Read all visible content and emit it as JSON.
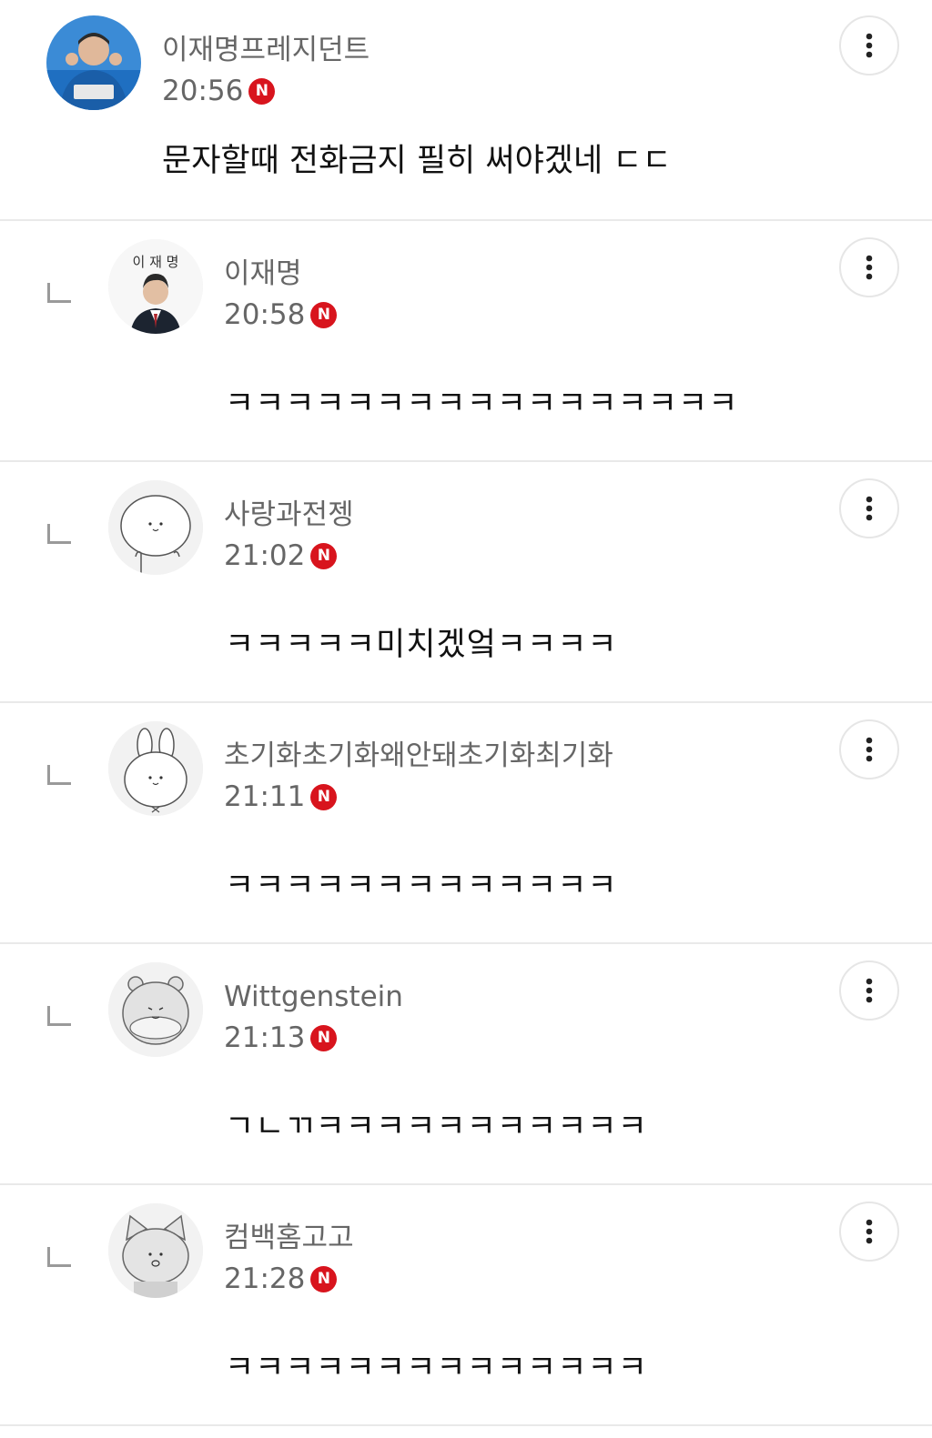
{
  "comments": [
    {
      "name": "이재명프레지던트",
      "time": "20:56",
      "badge": "N",
      "text": "문자할때 전화금지 필히 써야겠네 ㄷㄷ",
      "avatar": "photo-avatar-blue"
    },
    {
      "name": "이재명",
      "time": "20:58",
      "badge": "N",
      "text": "ㅋㅋㅋㅋㅋㅋㅋㅋㅋㅋㅋㅋㅋㅋㅋㅋㅋ",
      "avatar": "portrait-avatar",
      "avatar_caption": "이 재 명"
    },
    {
      "name": "사랑과전젱",
      "time": "21:02",
      "badge": "N",
      "text": "ㅋㅋㅋㅋㅋ미치겠엌ㅋㅋㅋㅋ",
      "avatar": "blob-character-avatar"
    },
    {
      "name": "초기화초기화왜안돼초기화최기화",
      "time": "21:11",
      "badge": "N",
      "text": "ㅋㅋㅋㅋㅋㅋㅋㅋㅋㅋㅋㅋㅋ",
      "avatar": "rabbit-character-avatar"
    },
    {
      "name": "Wittgenstein",
      "time": "21:13",
      "badge": "N",
      "text": "ㄱㄴㄲㅋㅋㅋㅋㅋㅋㅋㅋㅋㅋㅋ",
      "avatar": "bear-character-avatar"
    },
    {
      "name": "컴백홈고고",
      "time": "21:28",
      "badge": "N",
      "text": "ㅋㅋㅋㅋㅋㅋㅋㅋㅋㅋㅋㅋㅋㅋ",
      "avatar": "cat-character-avatar"
    }
  ],
  "colors": {
    "badge": "#d8141d",
    "meta_text": "#666666",
    "divider": "#e9e9e9",
    "avatar_blue": "#1f6fc1"
  },
  "icons": {
    "more": "more-vertical-icon",
    "reply": "reply-arrow-icon",
    "new": "new-badge-icon"
  }
}
